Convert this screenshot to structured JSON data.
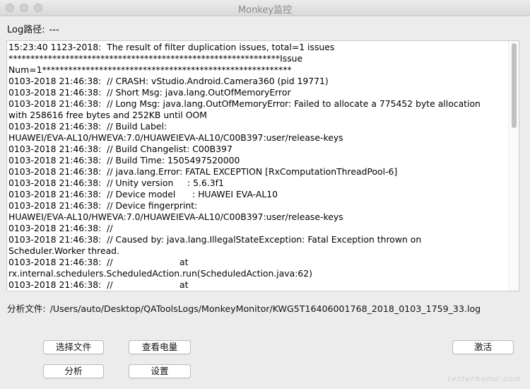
{
  "window": {
    "title": "Monkey监控"
  },
  "log_path": {
    "label": "Log路径:",
    "value": "---"
  },
  "log_lines": [
    "15:23:40 1123-2018:  The result of filter duplication issues, total=1 issues",
    "**************************************************************Issue",
    "Num=1*********************************************************",
    "0103-2018 21:46:38:  // CRASH: vStudio.Android.Camera360 (pid 19771)",
    "0103-2018 21:46:38:  // Short Msg: java.lang.OutOfMemoryError",
    "0103-2018 21:46:38:  // Long Msg: java.lang.OutOfMemoryError: Failed to allocate a 775452 byte allocation",
    "with 258616 free bytes and 252KB until OOM",
    "0103-2018 21:46:38:  // Build Label:",
    "HUAWEI/EVA-AL10/HWEVA:7.0/HUAWEIEVA-AL10/C00B397:user/release-keys",
    "0103-2018 21:46:38:  // Build Changelist: C00B397",
    "0103-2018 21:46:38:  // Build Time: 1505497520000",
    "0103-2018 21:46:38:  // java.lang.Error: FATAL EXCEPTION [RxComputationThreadPool-6]",
    "0103-2018 21:46:38:  // Unity version     : 5.6.3f1",
    "0103-2018 21:46:38:  // Device model      : HUAWEI EVA-AL10",
    "0103-2018 21:46:38:  // Device fingerprint:",
    "HUAWEI/EVA-AL10/HWEVA:7.0/HUAWEIEVA-AL10/C00B397:user/release-keys",
    "0103-2018 21:46:38:  //",
    "0103-2018 21:46:38:  // Caused by: java.lang.IllegalStateException: Fatal Exception thrown on",
    "Scheduler.Worker thread.",
    "0103-2018 21:46:38:  //                        at",
    "rx.internal.schedulers.ScheduledAction.run(ScheduledAction.java:62)",
    "0103-2018 21:46:38:  //                        at"
  ],
  "analysis_file": {
    "label": "分析文件:",
    "value": "/Users/auto/Desktop/QAToolsLogs/MonkeyMonitor/KWG5T16406001768_2018_0103_1759_33.log"
  },
  "buttons": {
    "select_file": "选择文件",
    "check_power": "查看电量",
    "activate": "激活",
    "analyze": "分析",
    "settings": "设置"
  },
  "watermark": "testerhome.com"
}
